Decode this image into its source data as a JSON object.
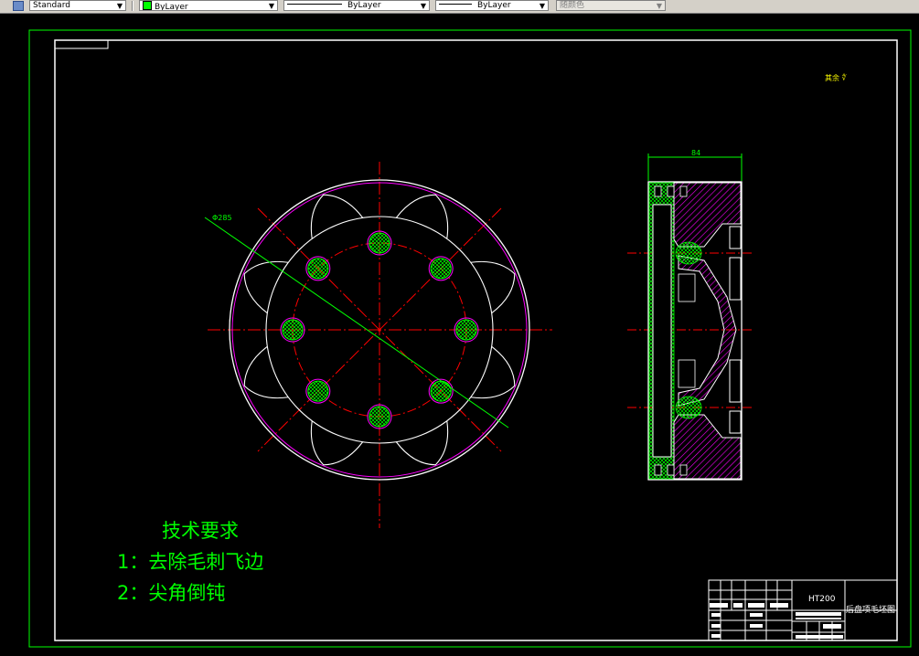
{
  "toolbar": {
    "text_style": "Standard",
    "layer": "ByLayer",
    "linetype": "ByLayer",
    "lineweight": "ByLayer",
    "plot_style": "随颜色",
    "layer_color": "#00ff00"
  },
  "drawing": {
    "diameter_dim": "Φ285",
    "width_dim": "84",
    "roughness_note": "其余 ∜"
  },
  "tech_req": {
    "title": "技术要求",
    "item1": "1：去除毛刺飞边",
    "item2": "2：尖角倒钝"
  },
  "title_block": {
    "material": "HT200",
    "part_name": "后盘项毛坯图"
  },
  "colors": {
    "background": "#000000",
    "frame": "#00ff00",
    "outline": "#ffffff",
    "centerline": "#ff0000",
    "hatch": "#ff00ff",
    "text": "#00ff00",
    "dim": "#00ff00",
    "note": "#ffff00"
  }
}
